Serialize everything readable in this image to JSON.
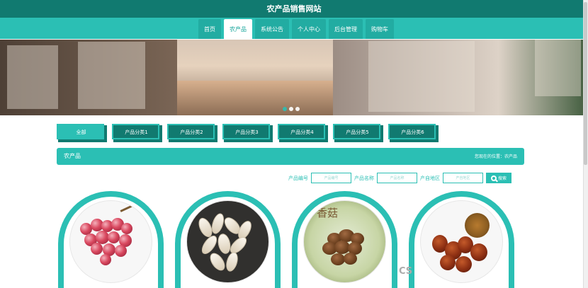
{
  "header": {
    "title": "农产品销售网站"
  },
  "nav": {
    "items": [
      {
        "label": "首页"
      },
      {
        "label": "农产品"
      },
      {
        "label": "系统公告"
      },
      {
        "label": "个人中心"
      },
      {
        "label": "后台管理"
      },
      {
        "label": "购物车"
      }
    ],
    "active_index": 1
  },
  "banner": {
    "slide_count": 3,
    "active_slide": 1
  },
  "categories": {
    "items": [
      {
        "label": "全部"
      },
      {
        "label": "产品分类1"
      },
      {
        "label": "产品分类2"
      },
      {
        "label": "产品分类3"
      },
      {
        "label": "产品分类4"
      },
      {
        "label": "产品分类5"
      },
      {
        "label": "产品分类6"
      }
    ]
  },
  "section": {
    "title": "农产品",
    "breadcrumb": "您现在的位置：农产品"
  },
  "search": {
    "fields": [
      {
        "label": "产品编号",
        "placeholder": "产品编号"
      },
      {
        "label": "产品名称",
        "placeholder": "产品名称"
      },
      {
        "label": "产自地区",
        "placeholder": "产自地区"
      }
    ],
    "button_label": "搜索"
  },
  "cards": [
    {
      "image": "grapes",
      "label": ""
    },
    {
      "image": "pumpkin-seeds",
      "label": ""
    },
    {
      "image": "mushrooms",
      "label": "香菇"
    },
    {
      "image": "chestnuts",
      "label": ""
    }
  ],
  "watermark": "CS",
  "colors": {
    "brand_dark": "#117a70",
    "brand": "#2bbfb4",
    "white": "#ffffff"
  }
}
